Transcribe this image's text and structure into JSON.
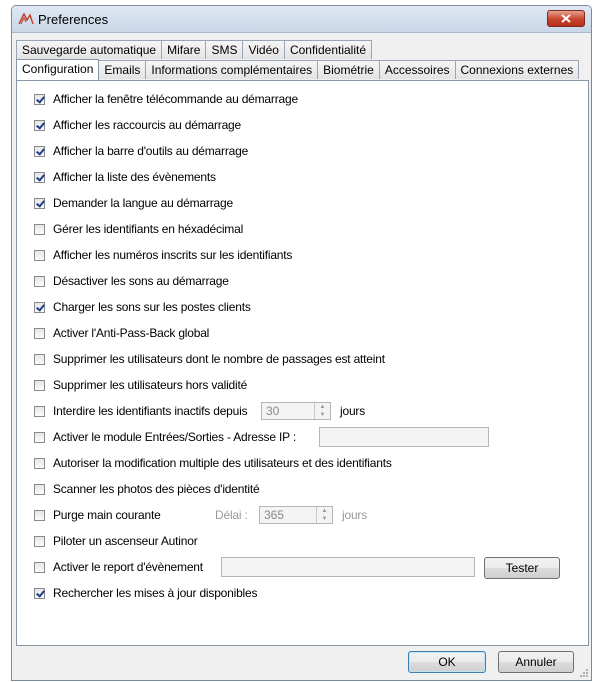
{
  "window": {
    "title": "Preferences"
  },
  "tabs": {
    "row1": [
      "Sauvegarde automatique",
      "Mifare",
      "SMS",
      "Vidéo",
      "Confidentialité"
    ],
    "row2": [
      "Configuration",
      "Emails",
      "Informations complémentaires",
      "Biométrie",
      "Accessoires",
      "Connexions externes"
    ],
    "active": "Configuration"
  },
  "options": [
    {
      "label": "Afficher la fenêtre télécommande au démarrage",
      "checked": true
    },
    {
      "label": "Afficher les raccourcis au démarrage",
      "checked": true
    },
    {
      "label": "Afficher la barre d'outils au démarrage",
      "checked": true
    },
    {
      "label": "Afficher la liste des évènements",
      "checked": true
    },
    {
      "label": "Demander la langue au démarrage",
      "checked": true
    },
    {
      "label": "Gérer les identifiants en héxadécimal",
      "checked": false
    },
    {
      "label": "Afficher les numéros inscrits sur les identifiants",
      "checked": false
    },
    {
      "label": "Désactiver les sons au démarrage",
      "checked": false
    },
    {
      "label": "Charger les sons sur les postes clients",
      "checked": true
    },
    {
      "label": "Activer l'Anti-Pass-Back global",
      "checked": false
    },
    {
      "label": "Supprimer les utilisateurs dont le nombre de passages est atteint",
      "checked": false
    },
    {
      "label": "Supprimer les utilisateurs hors validité",
      "checked": false
    },
    {
      "label": "Interdire les identifiants inactifs depuis",
      "checked": false
    },
    {
      "label": "Activer le module Entrées/Sorties - Adresse IP :",
      "checked": false
    },
    {
      "label": "Autoriser la modification multiple des utilisateurs et des identifiants",
      "checked": false
    },
    {
      "label": "Scanner les photos des pièces d'identité",
      "checked": false
    },
    {
      "label": "Purge main courante",
      "checked": false
    },
    {
      "label": "Piloter un ascenseur Autinor",
      "checked": false
    },
    {
      "label": "Activer le report d'évènement",
      "checked": false
    },
    {
      "label": "Rechercher les mises à jour disponibles",
      "checked": true
    }
  ],
  "inactive_days": {
    "value": "30",
    "unit": "jours"
  },
  "io_module": {
    "ip": ""
  },
  "purge": {
    "delay_label": "Délai :",
    "value": "365",
    "unit": "jours"
  },
  "event_report": {
    "value": "",
    "test_button": "Tester"
  },
  "footer": {
    "ok": "OK",
    "cancel": "Annuler"
  },
  "colors": {
    "close_button": "#c7432b",
    "check": "#1c3f8c",
    "titlebar": "#c9d7e8"
  }
}
